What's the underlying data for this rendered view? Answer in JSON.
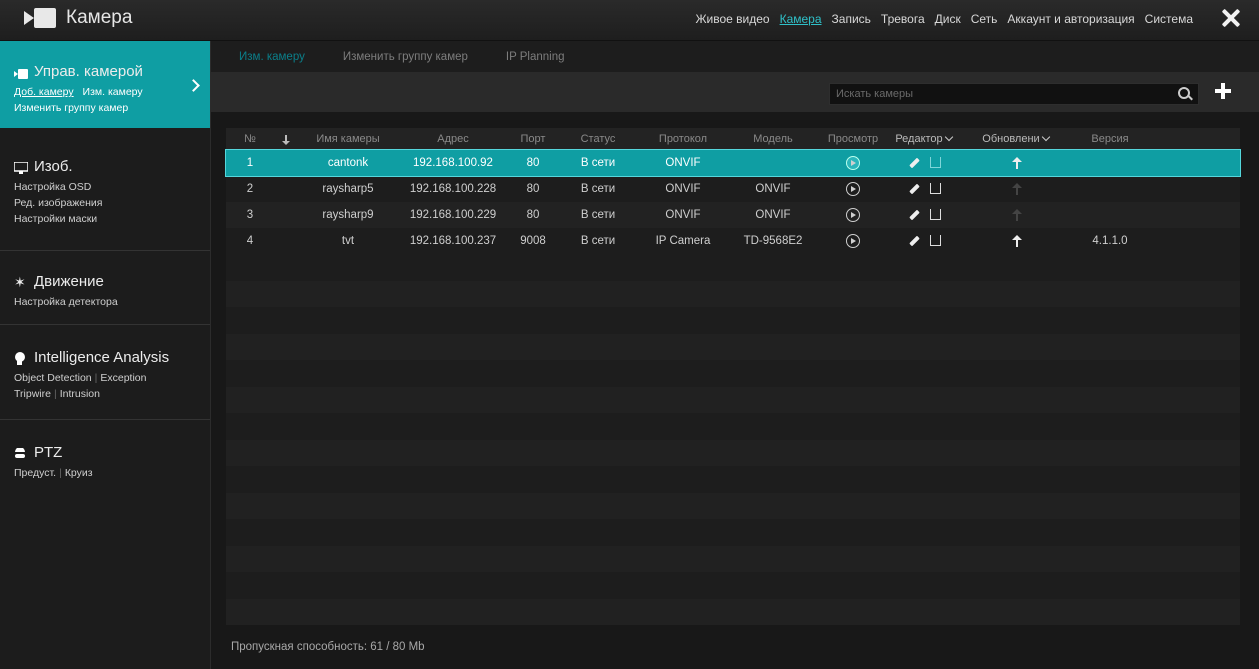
{
  "app": {
    "title": "Камера"
  },
  "topnav": [
    "Живое видео",
    "Камера",
    "Запись",
    "Тревога",
    "Диск",
    "Сеть",
    "Аккаунт и авторизация",
    "Система"
  ],
  "sidebar": {
    "camera": {
      "title": "Управ. камерой",
      "links": [
        "Доб. камеру",
        "Изм. камеру",
        "Изменить группу камер"
      ]
    },
    "image": {
      "title": "Изоб.",
      "links": [
        "Настройка OSD",
        "Ред. изображения",
        "Настройки маски"
      ]
    },
    "motion": {
      "title": "Движение",
      "links": [
        "Настройка детектора"
      ]
    },
    "intel": {
      "title": "Intelligence Analysis",
      "links": [
        "Object Detection",
        "Exception",
        "Tripwire",
        "Intrusion"
      ]
    },
    "ptz": {
      "title": "PTZ",
      "links": [
        "Предуст.",
        "Круиз"
      ]
    }
  },
  "subtabs": [
    "Изм. камеру",
    "Изменить группу камер",
    "IP Planning"
  ],
  "search": {
    "placeholder": "Искать камеры"
  },
  "table": {
    "headers": [
      "№",
      "Имя камеры",
      "Адрес",
      "Порт",
      "Статус",
      "Протокол",
      "Модель",
      "Просмотр",
      "Редактор",
      "Обновлени",
      "Версия"
    ],
    "rows": [
      {
        "no": "1",
        "name": "cantonk",
        "addr": "192.168.100.92",
        "port": "80",
        "status": "В сети",
        "proto": "ONVIF",
        "model": "",
        "version": ""
      },
      {
        "no": "2",
        "name": "raysharp5",
        "addr": "192.168.100.228",
        "port": "80",
        "status": "В сети",
        "proto": "ONVIF",
        "model": "ONVIF",
        "version": ""
      },
      {
        "no": "3",
        "name": "raysharp9",
        "addr": "192.168.100.229",
        "port": "80",
        "status": "В сети",
        "proto": "ONVIF",
        "model": "ONVIF",
        "version": ""
      },
      {
        "no": "4",
        "name": "tvt",
        "addr": "192.168.100.237",
        "port": "9008",
        "status": "В сети",
        "proto": "IP Camera",
        "model": "TD-9568E2",
        "version": "4.1.1.0"
      }
    ]
  },
  "footer": {
    "bandwidth": "Пропускная способность: 61 / 80 Mb"
  },
  "colors": {
    "accent": "#0f9ea3",
    "active_link": "#2fc0c8"
  }
}
